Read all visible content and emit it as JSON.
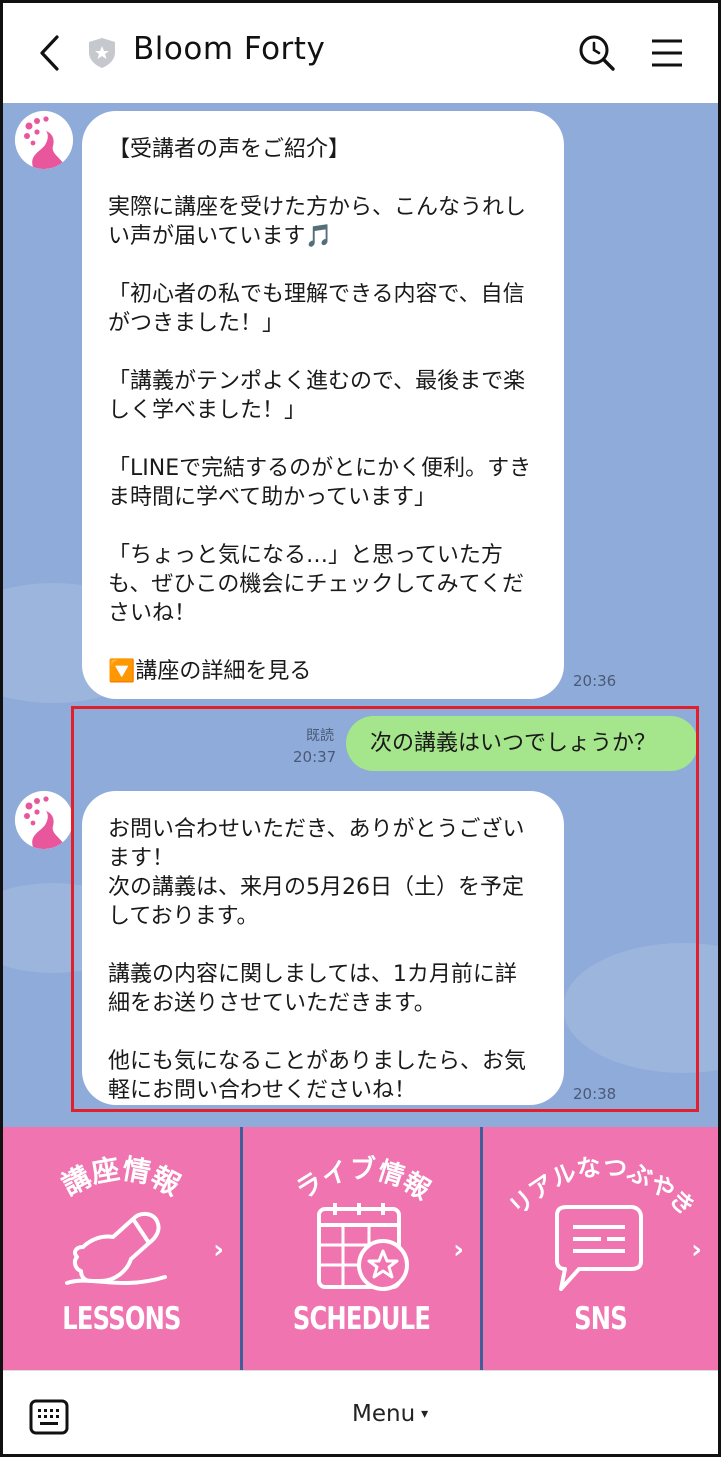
{
  "header": {
    "title": "Bloom Forty"
  },
  "messages": [
    {
      "direction": "in",
      "text": "【受講者の声をご紹介】\n\n実際に講座を受けた方から、こんなうれしい声が届いています🎵\n\n「初心者の私でも理解できる内容で、自信がつきました！」\n\n「講義がテンポよく進むので、最後まで楽しく学べました！」\n\n「LINEで完結するのがとにかく便利。すきま時間に学べて助かっています」\n\n「ちょっと気になる…」と思っていた方も、ぜひこの機会にチェックしてみてくださいね！\n\n🔽講座の詳細を見る",
      "time": "20:36"
    },
    {
      "direction": "out",
      "text": "次の講義はいつでしょうか？",
      "status": "既読",
      "time": "20:37"
    },
    {
      "direction": "in",
      "text": "お問い合わせいただき、ありがとうございます！\n次の講義は、来月の5月26日（土）を予定しております。\n\n講義の内容に関しましては、1カ月前に詳細をお送りさせていただきます。\n\n他にも気になることがありましたら、お気軽にお問い合わせくださいね！",
      "time": "20:38"
    }
  ],
  "rich_menu": [
    {
      "arc_text": "講座情報",
      "label": "LESSONS",
      "icon": "pen-hand-icon"
    },
    {
      "arc_text": "ライブ情報",
      "label": "SCHEDULE",
      "icon": "calendar-star-icon"
    },
    {
      "arc_text": "リアルなつぶやき",
      "label": "SNS",
      "icon": "speech-bubble-icon"
    }
  ],
  "bottom_bar": {
    "menu_label": "Menu",
    "menu_caret": "▾"
  },
  "colors": {
    "chat_background": "#8fabd9",
    "incoming_bubble": "#ffffff",
    "outgoing_bubble": "#a5e58b",
    "rich_menu_pink": "#ef74b0",
    "highlight_border": "#e0202a"
  }
}
